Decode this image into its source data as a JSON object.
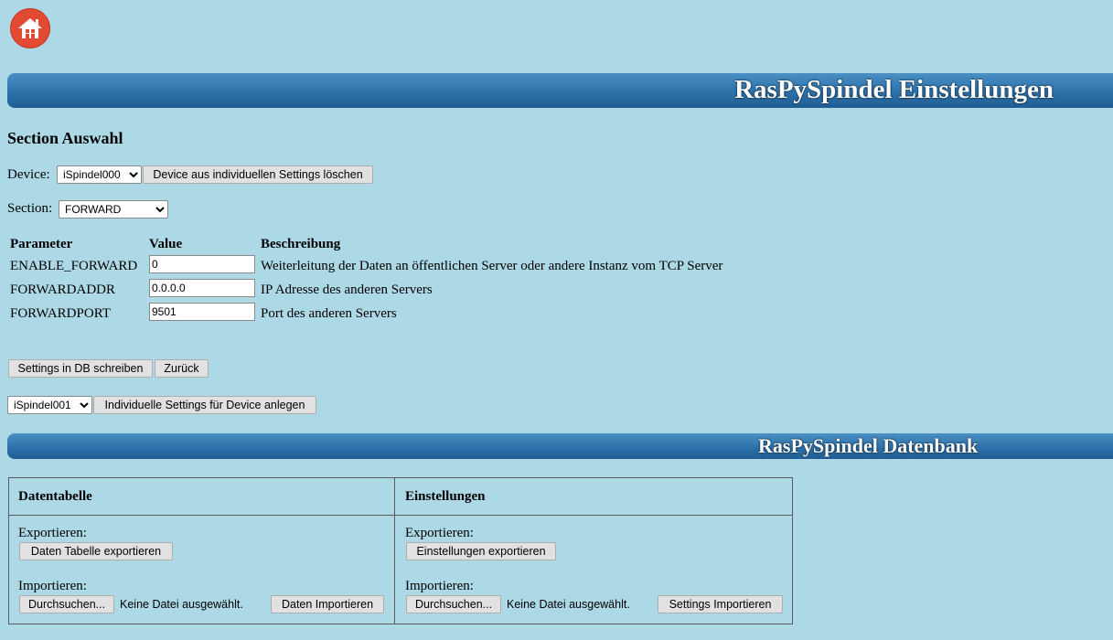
{
  "home": {
    "icon": "home-icon"
  },
  "header": {
    "title": "RasPySpindel Einstellungen"
  },
  "section": {
    "title": "Section Auswahl",
    "device_label": "Device:",
    "device_selected": "iSpindel000",
    "delete_button": "Device aus individuellen Settings löschen",
    "section_label": "Section:",
    "section_selected": "FORWARD"
  },
  "params": {
    "headers": [
      "Parameter",
      "Value",
      "Beschreibung"
    ],
    "rows": [
      {
        "name": "ENABLE_FORWARD",
        "value": "0",
        "desc": "Weiterleitung der Daten an öffentlichen Server oder andere Instanz vom TCP Server"
      },
      {
        "name": "FORWARDADDR",
        "value": "0.0.0.0",
        "desc": "IP Adresse des anderen Servers"
      },
      {
        "name": "FORWARDPORT",
        "value": "9501",
        "desc": "Port des anderen Servers"
      }
    ]
  },
  "actions": {
    "write_button": "Settings in DB schreiben",
    "back_button": "Zurück",
    "new_device_selected": "iSpindel001",
    "create_button": "Individuelle Settings für Device anlegen"
  },
  "db": {
    "title": "RasPySpindel Datenbank",
    "left": {
      "header": "Datentabelle",
      "export_label": "Exportieren:",
      "export_button": "Daten Tabelle exportieren",
      "import_label": "Importieren:",
      "browse_button": "Durchsuchen...",
      "no_file": "Keine Datei ausgewählt.",
      "import_button": "Daten Importieren"
    },
    "right": {
      "header": "Einstellungen",
      "export_label": "Exportieren:",
      "export_button": "Einstellungen exportieren",
      "import_label": "Importieren:",
      "browse_button": "Durchsuchen...",
      "no_file": "Keine Datei ausgewählt.",
      "import_button": "Settings Importieren"
    }
  },
  "colors": {
    "background": "#add8e6",
    "banner": "#2f74ad",
    "home": "#e24a33"
  }
}
